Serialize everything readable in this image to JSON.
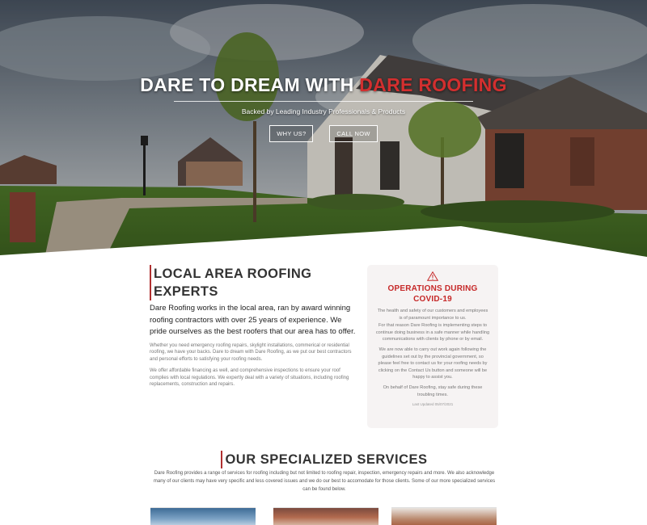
{
  "hero": {
    "title_main": "DARE TO DREAM WITH ",
    "title_accent": "DARE ROOFING",
    "subtitle": "Backed by Leading Industry Professionals & Products",
    "buttons": [
      {
        "label": "WHY US?"
      },
      {
        "label": "CALL NOW"
      }
    ]
  },
  "about": {
    "heading": "LOCAL AREA ROOFING EXPERTS",
    "lead": "Dare Roofing works in the local area, ran by award winning roofing contractors with over 25 years of experience. We pride ourselves as the best roofers that our area has to offer.",
    "paragraphs": [
      "Whether you need emergency roofing repairs, skylight installations, commerical or residential roofing, we have your backs. Dare to dream with Dare Roofing, as we put our best contractors and personal efforts to satisfying your roofing needs.",
      "We offer affordable financing as well, and comprehensive inspections to ensure your roof complies with local regulations. We expertly deal with a variety of situations, including roofing replacements, construction and repairs."
    ]
  },
  "covid": {
    "icon": "warning-triangle-icon",
    "title": "OPERATIONS DURING COVID-19",
    "paragraphs": [
      "The health and safety of our customers and employees is of paramount importance to us.",
      "For that reason Dare Roofing is implementing steps to continue doing business in a safe manner while handling communications with clients by phone or by email.",
      "We are now able to carry out work again following the guidelines set out by the provincial government, so please feel free to contact us for your roofing needs by clicking on the Contact Us button and someone will be happy to assist you.",
      "On behalf of Dare Roofing, stay safe during these troubling times."
    ],
    "updated": "Last Updated 05/07/2021"
  },
  "services": {
    "heading": "OUR SPECIALIZED SERVICES",
    "description": "Dare Roofing provides a range of services for roofing including but not limited to roofing repair, inspection, emergency repairs and more. We also acknowledge many of our clients may have very specific and less covered issues and we do our best to accomodate for those clients. Some of our more specialized services can be found below."
  },
  "colors": {
    "accent": "#d32f2f",
    "heading_border": "#b03030",
    "covid_card_bg": "#f6f3f3"
  }
}
